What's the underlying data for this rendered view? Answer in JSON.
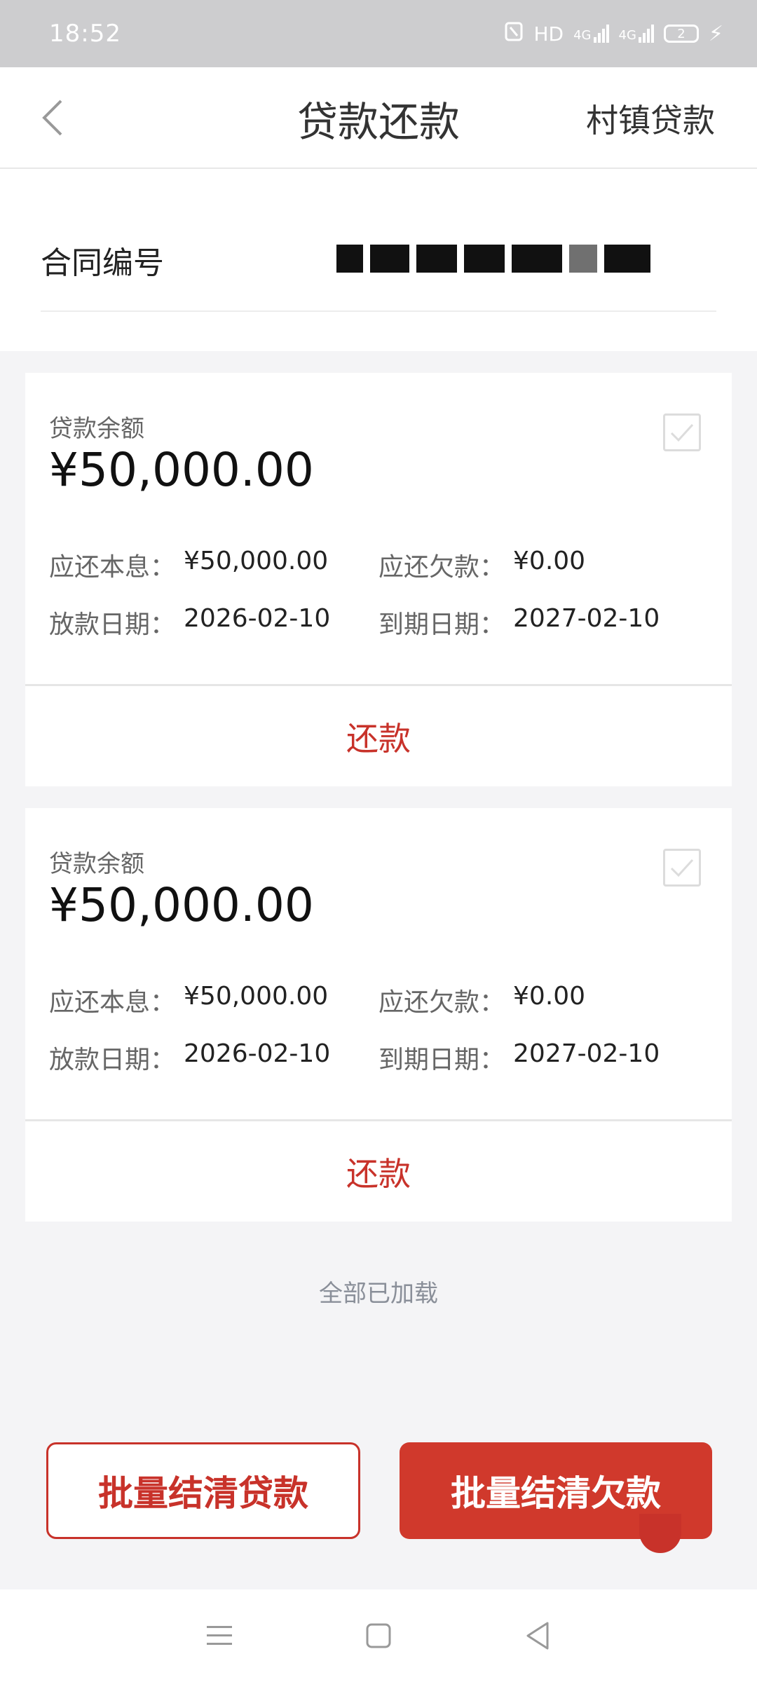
{
  "status_bar": {
    "time": "18:52",
    "nfc_icon": "nfc-icon",
    "hd_label": "HD",
    "signal1_label": "4G",
    "signal2_label": "4G",
    "battery_level": "2",
    "charging_icon": "bolt-icon"
  },
  "header": {
    "title": "贷款还款",
    "right_link": "村镇贷款"
  },
  "contract": {
    "label": "合同编号"
  },
  "loans": [
    {
      "balance_label": "贷款余额",
      "balance": "¥50,000.00",
      "principal_label": "应还本息：",
      "principal": "¥50,000.00",
      "arrears_label": "应还欠款：",
      "arrears": "¥0.00",
      "issue_label": "放款日期：",
      "issue_date": "2026-02-10",
      "due_label": "到期日期：",
      "due_date": "2027-02-10",
      "repay_label": "还款"
    },
    {
      "balance_label": "贷款余额",
      "balance": "¥50,000.00",
      "principal_label": "应还本息：",
      "principal": "¥50,000.00",
      "arrears_label": "应还欠款：",
      "arrears": "¥0.00",
      "issue_label": "放款日期：",
      "issue_date": "2026-02-10",
      "due_label": "到期日期：",
      "due_date": "2027-02-10",
      "repay_label": "还款"
    }
  ],
  "footer_note": "全部已加载",
  "actions": {
    "settle_loans": "批量结清贷款",
    "settle_arrears": "批量结清欠款"
  },
  "colors": {
    "accent": "#c8322a",
    "status_bar": "#cdcdcf",
    "background": "#f4f4f6"
  }
}
